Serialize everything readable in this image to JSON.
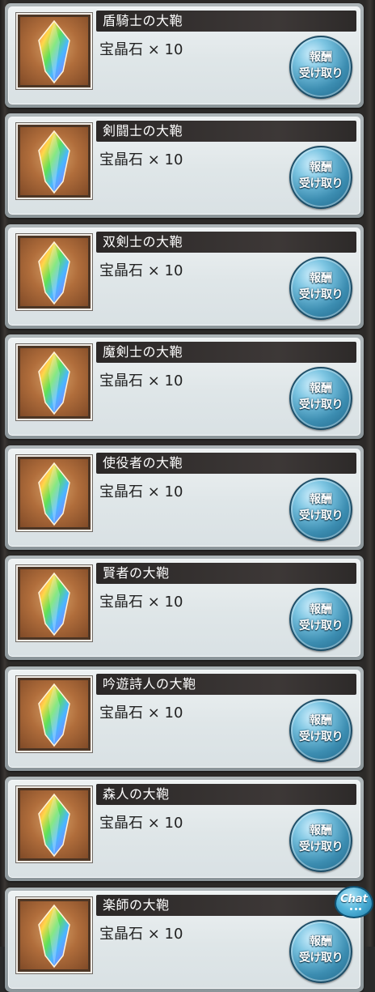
{
  "rewards": [
    {
      "title": "盾騎士の大鞄",
      "item": "宝晶石 × 10",
      "claim_line1": "報酬",
      "claim_line2": "受け取り"
    },
    {
      "title": "剣闘士の大鞄",
      "item": "宝晶石 × 10",
      "claim_line1": "報酬",
      "claim_line2": "受け取り"
    },
    {
      "title": "双剣士の大鞄",
      "item": "宝晶石 × 10",
      "claim_line1": "報酬",
      "claim_line2": "受け取り"
    },
    {
      "title": "魔剣士の大鞄",
      "item": "宝晶石 × 10",
      "claim_line1": "報酬",
      "claim_line2": "受け取り"
    },
    {
      "title": "使役者の大鞄",
      "item": "宝晶石 × 10",
      "claim_line1": "報酬",
      "claim_line2": "受け取り"
    },
    {
      "title": "賢者の大鞄",
      "item": "宝晶石 × 10",
      "claim_line1": "報酬",
      "claim_line2": "受け取り"
    },
    {
      "title": "吟遊詩人の大鞄",
      "item": "宝晶石 × 10",
      "claim_line1": "報酬",
      "claim_line2": "受け取り"
    },
    {
      "title": "森人の大鞄",
      "item": "宝晶石 × 10",
      "claim_line1": "報酬",
      "claim_line2": "受け取り"
    },
    {
      "title": "楽師の大鞄",
      "item": "宝晶石 × 10",
      "claim_line1": "報酬",
      "claim_line2": "受け取り"
    }
  ],
  "chat_button": {
    "label": "Chat"
  },
  "icons": {
    "thumbnail": "crystal-icon",
    "chat": "chat-bubble-icon"
  },
  "colors": {
    "title_bar": "#2b2827",
    "claim_button": "#3c8db1",
    "card_border": "#8b9599"
  }
}
